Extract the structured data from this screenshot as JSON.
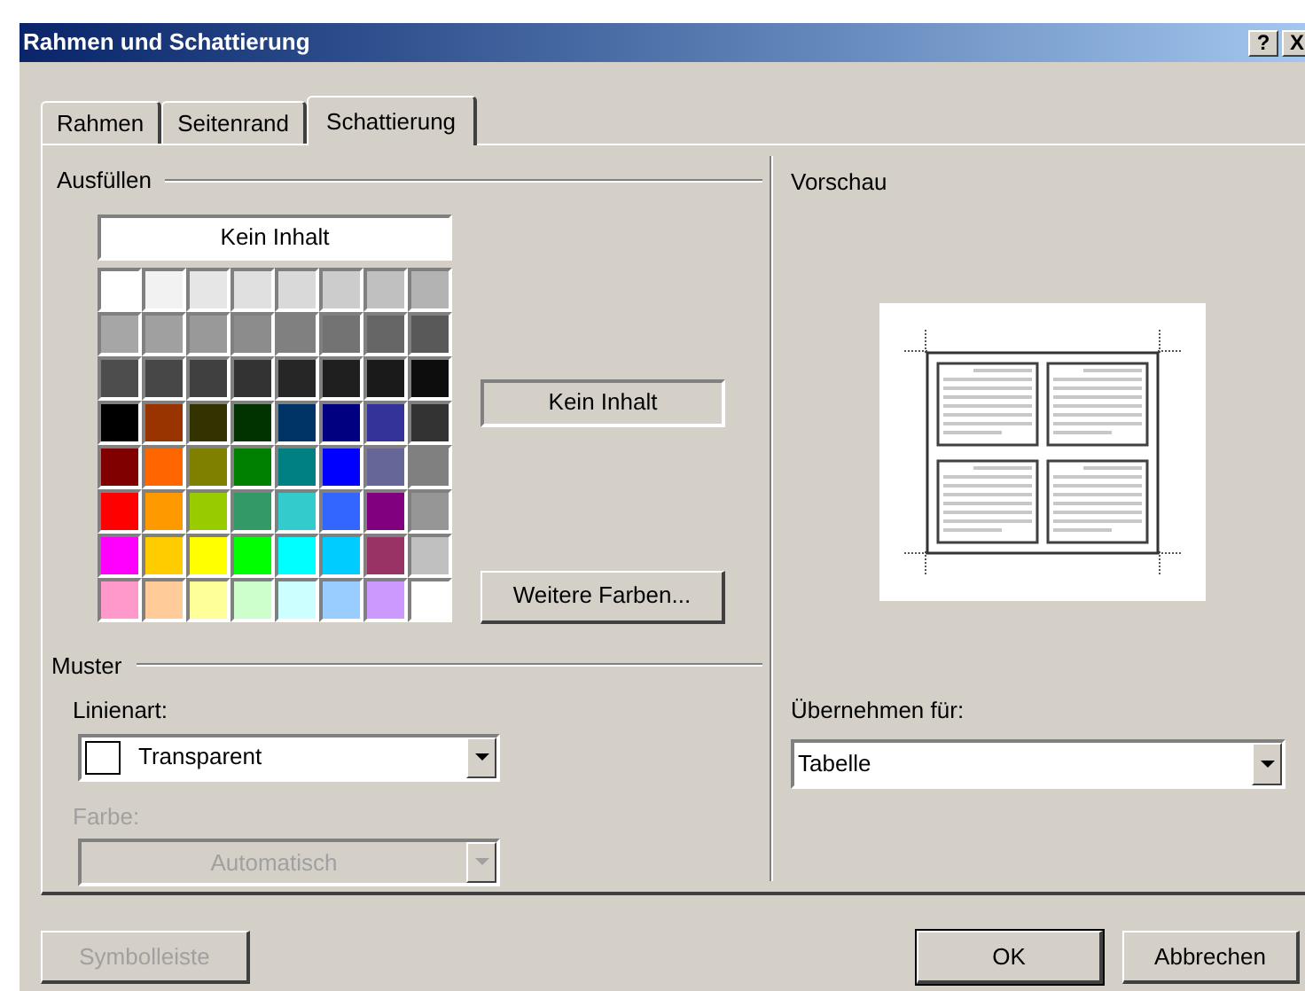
{
  "window": {
    "title": "Rahmen und Schattierung",
    "help_button": "?",
    "close_button": "X"
  },
  "tabs": [
    {
      "label": "Rahmen",
      "selected": false
    },
    {
      "label": "Seitenrand",
      "selected": false
    },
    {
      "label": "Schattierung",
      "selected": true
    }
  ],
  "fill": {
    "heading": "Ausfüllen",
    "no_fill_button": "Kein Inhalt",
    "swatch_rows": [
      [
        {
          "color": "#ffffff"
        },
        {
          "color": "#f2f2f2"
        },
        {
          "color": "#e6e6e6"
        },
        {
          "color": "#e0e0e0"
        },
        {
          "color": "#d9d9d9"
        },
        {
          "color": "#cccccc"
        },
        {
          "color": "#c0c0c0"
        },
        {
          "color": "#b3b3b3"
        }
      ],
      [
        {
          "color": "#a6a6a6"
        },
        {
          "color": "#a0a0a0"
        },
        {
          "color": "#999999"
        },
        {
          "color": "#8c8c8c"
        },
        {
          "color": "#808080"
        },
        {
          "color": "#737373"
        },
        {
          "color": "#666666"
        },
        {
          "color": "#595959"
        }
      ],
      [
        {
          "color": "#4d4d4d"
        },
        {
          "color": "#474747"
        },
        {
          "color": "#404040"
        },
        {
          "color": "#333333"
        },
        {
          "color": "#262626"
        },
        {
          "color": "#1f1f1f"
        },
        {
          "color": "#1a1a1a"
        },
        {
          "color": "#0d0d0d"
        }
      ],
      [
        {
          "color": "#000000"
        },
        {
          "color": "#993300"
        },
        {
          "color": "#333300"
        },
        {
          "color": "#003300"
        },
        {
          "color": "#003366"
        },
        {
          "color": "#000080"
        },
        {
          "color": "#333399"
        },
        {
          "color": "#333333"
        }
      ],
      [
        {
          "color": "#800000"
        },
        {
          "color": "#ff6600"
        },
        {
          "color": "#808000"
        },
        {
          "color": "#008000"
        },
        {
          "color": "#008080"
        },
        {
          "color": "#0000ff"
        },
        {
          "color": "#666699"
        },
        {
          "color": "#808080"
        }
      ],
      [
        {
          "color": "#ff0000"
        },
        {
          "color": "#ff9900"
        },
        {
          "color": "#99cc00"
        },
        {
          "color": "#339966"
        },
        {
          "color": "#33cccc"
        },
        {
          "color": "#3366ff"
        },
        {
          "color": "#800080"
        },
        {
          "color": "#969696"
        }
      ],
      [
        {
          "color": "#ff00ff"
        },
        {
          "color": "#ffcc00"
        },
        {
          "color": "#ffff00"
        },
        {
          "color": "#00ff00"
        },
        {
          "color": "#00ffff"
        },
        {
          "color": "#00ccff"
        },
        {
          "color": "#993366"
        },
        {
          "color": "#c0c0c0"
        }
      ],
      [
        {
          "color": "#ff99cc"
        },
        {
          "color": "#ffcc99"
        },
        {
          "color": "#ffff99"
        },
        {
          "color": "#ccffcc"
        },
        {
          "color": "#ccffff"
        },
        {
          "color": "#99ccff"
        },
        {
          "color": "#cc99ff"
        },
        {
          "color": "#ffffff"
        }
      ]
    ],
    "current": "Kein Inhalt",
    "more_colors_button": "Weitere Farben..."
  },
  "pattern": {
    "heading": "Muster",
    "style_label": "Linienart:",
    "style_value": "Transparent",
    "color_label": "Farbe:",
    "color_value": "Automatisch",
    "color_disabled": true
  },
  "preview": {
    "heading": "Vorschau",
    "apply_label": "Übernehmen für:",
    "apply_value": "Tabelle"
  },
  "buttons": [
    {
      "label": "Symbolleiste",
      "disabled": true
    },
    {
      "label": "OK",
      "disabled": false
    },
    {
      "label": "Abbrechen",
      "disabled": false
    }
  ]
}
